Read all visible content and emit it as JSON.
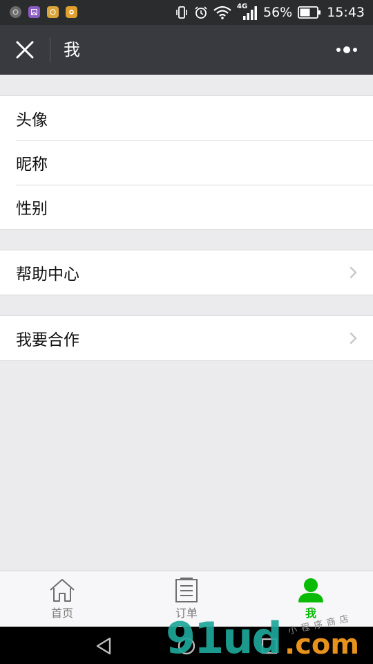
{
  "status_bar": {
    "battery": "56%",
    "time": "15:43",
    "network": "4G",
    "app_icons": [
      "app-icon-1",
      "app-icon-2",
      "app-icon-3",
      "app-icon-4"
    ]
  },
  "nav": {
    "title": "我",
    "close_icon": "close-icon",
    "more_icon": "more-icon"
  },
  "profile_items": [
    {
      "label": "头像"
    },
    {
      "label": "昵称"
    },
    {
      "label": "性别"
    }
  ],
  "help": {
    "label": "帮助中心"
  },
  "cooperate": {
    "label": "我要合作"
  },
  "tabs": [
    {
      "label": "首页",
      "icon": "home-icon"
    },
    {
      "label": "订单",
      "icon": "order-list-icon"
    },
    {
      "label": "我",
      "icon": "user-icon",
      "active": true
    }
  ],
  "colors": {
    "accent": "#09bb07",
    "navbar": "#393a3f",
    "statusbar": "#2b2c2e",
    "background": "#ebebed"
  },
  "watermark": {
    "logo": "91ud",
    "domain": ".com",
    "small": "小程序商店"
  }
}
